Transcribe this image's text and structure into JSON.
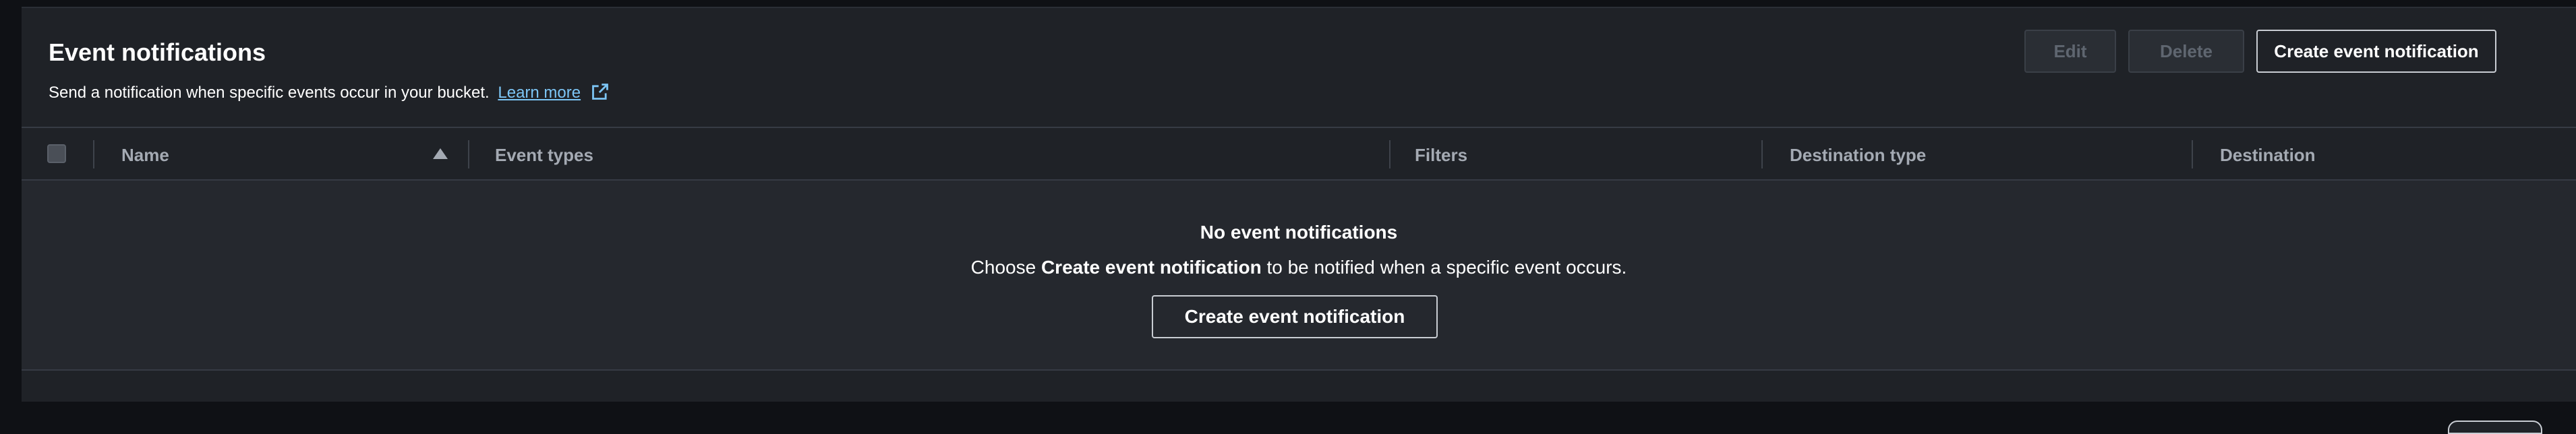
{
  "section": {
    "title": "Event notifications",
    "description": "Send a notification when specific events occur in your bucket.",
    "learn_more": "Learn more"
  },
  "header_actions": {
    "edit": "Edit",
    "delete": "Delete",
    "create": "Create event notification"
  },
  "table": {
    "columns": [
      "Name",
      "Event types",
      "Filters",
      "Destination type",
      "Destination"
    ]
  },
  "empty_state": {
    "title": "No event notifications",
    "text_prefix": "Choose",
    "text_bold": "Create event notification",
    "text_suffix": "to be notified when a specific event occurs.",
    "button": "Create event notification"
  },
  "icons": {
    "external_link": "external-link-icon",
    "sort": "sort-ascending-icon"
  },
  "colors": {
    "link": "#7cc5f5",
    "panel_bg": "#1f2227",
    "empty_bg": "#25282e"
  }
}
